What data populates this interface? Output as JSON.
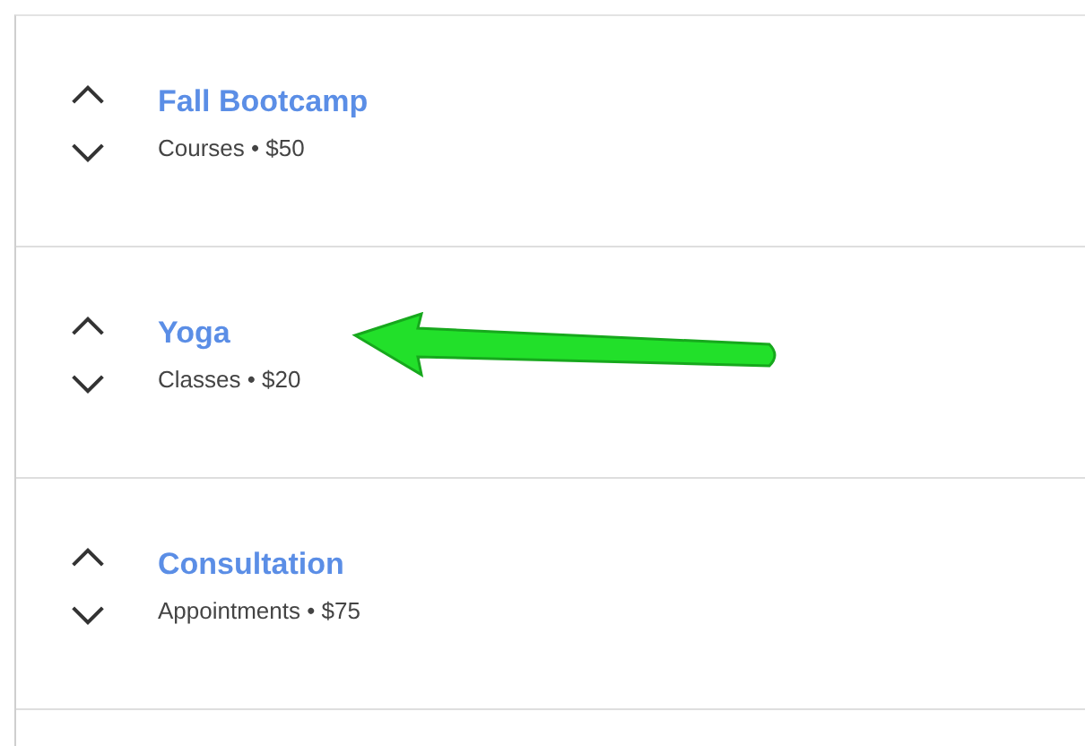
{
  "items": [
    {
      "title": "Fall Bootcamp",
      "subtitle": "Courses • $50",
      "pointer": false
    },
    {
      "title": "Yoga",
      "subtitle": "Classes • $20",
      "pointer": true
    },
    {
      "title": "Consultation",
      "subtitle": "Appointments • $75",
      "pointer": false
    }
  ]
}
